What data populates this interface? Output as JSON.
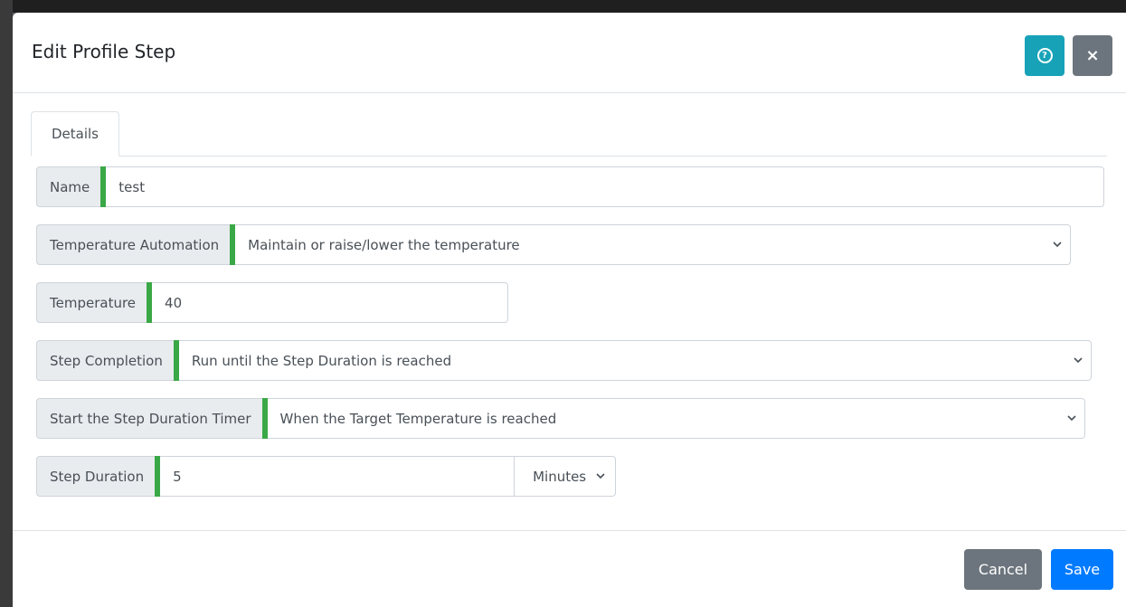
{
  "modal": {
    "title": "Edit Profile Step",
    "help_icon": "question-circle-icon",
    "close_icon": "close-x-icon",
    "close_glyph": "×",
    "help_glyph": "?"
  },
  "tabs": [
    {
      "label": "Details",
      "active": true
    }
  ],
  "form": {
    "name": {
      "label": "Name",
      "value": "test"
    },
    "temperature_automation": {
      "label": "Temperature Automation",
      "value": "Maintain or raise/lower the temperature"
    },
    "temperature": {
      "label": "Temperature",
      "value": "40"
    },
    "step_completion": {
      "label": "Step Completion",
      "value": "Run until the Step Duration is reached"
    },
    "start_timer": {
      "label": "Start the Step Duration Timer",
      "value": "When the Target Temperature is reached"
    },
    "step_duration": {
      "label": "Step Duration",
      "value": "5",
      "unit": "Minutes"
    }
  },
  "footer": {
    "cancel_label": "Cancel",
    "save_label": "Save"
  },
  "colors": {
    "accent": "#3aa846",
    "help": "#17a2b8",
    "secondary": "#6c757d",
    "primary": "#007bff"
  }
}
